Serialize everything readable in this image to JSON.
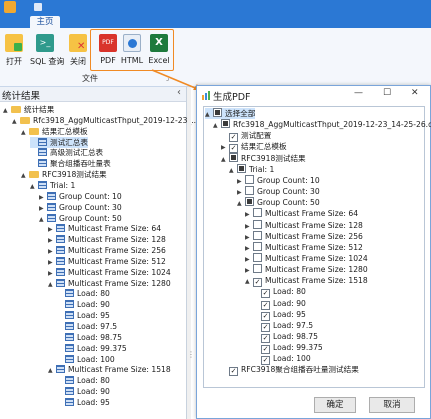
{
  "ribbon": {
    "tab": "主页",
    "buttons": [
      {
        "label": "打开",
        "icon": "open-icon"
      },
      {
        "label": "SQL 查询",
        "icon": "sql-query-icon"
      },
      {
        "label": "关闭",
        "icon": "close-db-icon"
      },
      {
        "label": "PDF",
        "icon": "pdf-icon"
      },
      {
        "label": "HTML",
        "icon": "html-icon"
      },
      {
        "label": "Excel",
        "icon": "excel-icon"
      }
    ],
    "group_label": "文件",
    "colors": {
      "title_bar": "#2b78d4",
      "highlight": "#f08a24"
    }
  },
  "left_panel": {
    "title": "统计结果",
    "collapse": "‹",
    "rows": [
      {
        "label": "统计结果",
        "level": 0,
        "icon": "folder",
        "arrow": "▲"
      },
      {
        "label": "Rfc3918_AggMulticastThput_2019-12-23_...",
        "level": 1,
        "icon": "folder",
        "arrow": "▲"
      },
      {
        "label": "结果汇总模板",
        "level": 2,
        "icon": "folder",
        "arrow": "▲"
      },
      {
        "label": "测试汇总表",
        "level": 3,
        "icon": "table",
        "selected": true
      },
      {
        "label": "高级测试汇总表",
        "level": 3,
        "icon": "table"
      },
      {
        "label": "聚合组播吞吐量表",
        "level": 3,
        "icon": "table"
      },
      {
        "label": "RFC3918测试结果",
        "level": 2,
        "icon": "folder",
        "arrow": "▲"
      },
      {
        "label": "Trial: 1",
        "level": 3,
        "icon": "table",
        "arrow": "▲"
      },
      {
        "label": "Group Count: 10",
        "level": 4,
        "icon": "table",
        "arrow": "▶"
      },
      {
        "label": "Group Count: 30",
        "level": 4,
        "icon": "table",
        "arrow": "▶"
      },
      {
        "label": "Group Count: 50",
        "level": 4,
        "icon": "table",
        "arrow": "▲"
      },
      {
        "label": "Multicast Frame Size: 64",
        "level": 5,
        "icon": "table",
        "arrow": "▶"
      },
      {
        "label": "Multicast Frame Size: 128",
        "level": 5,
        "icon": "table",
        "arrow": "▶"
      },
      {
        "label": "Multicast Frame Size: 256",
        "level": 5,
        "icon": "table",
        "arrow": "▶"
      },
      {
        "label": "Multicast Frame Size: 512",
        "level": 5,
        "icon": "table",
        "arrow": "▶"
      },
      {
        "label": "Multicast Frame Size: 1024",
        "level": 5,
        "icon": "table",
        "arrow": "▶"
      },
      {
        "label": "Multicast Frame Size: 1280",
        "level": 5,
        "icon": "table",
        "arrow": "▲"
      },
      {
        "label": "Load: 80",
        "level": 6,
        "icon": "table"
      },
      {
        "label": "Load: 90",
        "level": 6,
        "icon": "table"
      },
      {
        "label": "Load: 95",
        "level": 6,
        "icon": "table"
      },
      {
        "label": "Load: 97.5",
        "level": 6,
        "icon": "table"
      },
      {
        "label": "Load: 98.75",
        "level": 6,
        "icon": "table"
      },
      {
        "label": "Load: 99.375",
        "level": 6,
        "icon": "table"
      },
      {
        "label": "Load: 100",
        "level": 6,
        "icon": "table"
      },
      {
        "label": "Multicast Frame Size: 1518",
        "level": 5,
        "icon": "table",
        "arrow": "▲"
      },
      {
        "label": "Load: 80",
        "level": 6,
        "icon": "table"
      },
      {
        "label": "Load: 90",
        "level": 6,
        "icon": "table"
      },
      {
        "label": "Load: 95",
        "level": 6,
        "icon": "table"
      }
    ]
  },
  "dialog": {
    "title": "生成PDF",
    "controls": {
      "minimize": "—",
      "maximize": "☐",
      "close": "✕"
    },
    "rows": [
      {
        "label": "选择全部",
        "level": 0,
        "check": "part",
        "arrow": "▲",
        "selected": true
      },
      {
        "label": "Rfc3918_AggMulticastThput_2019-12-23_14-25-26.db",
        "level": 1,
        "check": "part",
        "arrow": "▲"
      },
      {
        "label": "测试配置",
        "level": 2,
        "check": "checked"
      },
      {
        "label": "结果汇总模板",
        "level": 2,
        "check": "checked",
        "arrow": "▶"
      },
      {
        "label": "RFC3918测试结果",
        "level": 2,
        "check": "part",
        "arrow": "▲"
      },
      {
        "label": "Trial: 1",
        "level": 3,
        "check": "part",
        "arrow": "▲"
      },
      {
        "label": "Group Count: 10",
        "level": 4,
        "check": "empty",
        "arrow": "▶"
      },
      {
        "label": "Group Count: 30",
        "level": 4,
        "check": "empty",
        "arrow": "▶"
      },
      {
        "label": "Group Count: 50",
        "level": 4,
        "check": "part",
        "arrow": "▲"
      },
      {
        "label": "Multicast Frame Size: 64",
        "level": 5,
        "check": "empty",
        "arrow": "▶"
      },
      {
        "label": "Multicast Frame Size: 128",
        "level": 5,
        "check": "empty",
        "arrow": "▶"
      },
      {
        "label": "Multicast Frame Size: 256",
        "level": 5,
        "check": "empty",
        "arrow": "▶"
      },
      {
        "label": "Multicast Frame Size: 512",
        "level": 5,
        "check": "empty",
        "arrow": "▶"
      },
      {
        "label": "Multicast Frame Size: 1024",
        "level": 5,
        "check": "empty",
        "arrow": "▶"
      },
      {
        "label": "Multicast Frame Size: 1280",
        "level": 5,
        "check": "empty",
        "arrow": "▶"
      },
      {
        "label": "Multicast Frame Size: 1518",
        "level": 5,
        "check": "checked",
        "arrow": "▲"
      },
      {
        "label": "Load: 80",
        "level": 6,
        "check": "checked"
      },
      {
        "label": "Load: 90",
        "level": 6,
        "check": "checked"
      },
      {
        "label": "Load: 95",
        "level": 6,
        "check": "checked"
      },
      {
        "label": "Load: 97.5",
        "level": 6,
        "check": "checked"
      },
      {
        "label": "Load: 98.75",
        "level": 6,
        "check": "checked"
      },
      {
        "label": "Load: 99.375",
        "level": 6,
        "check": "checked"
      },
      {
        "label": "Load: 100",
        "level": 6,
        "check": "checked"
      },
      {
        "label": "RFC3918聚合组播吞吐量测试结果",
        "level": 2,
        "check": "checked"
      }
    ],
    "ok_label": "确定",
    "cancel_label": "取消"
  }
}
